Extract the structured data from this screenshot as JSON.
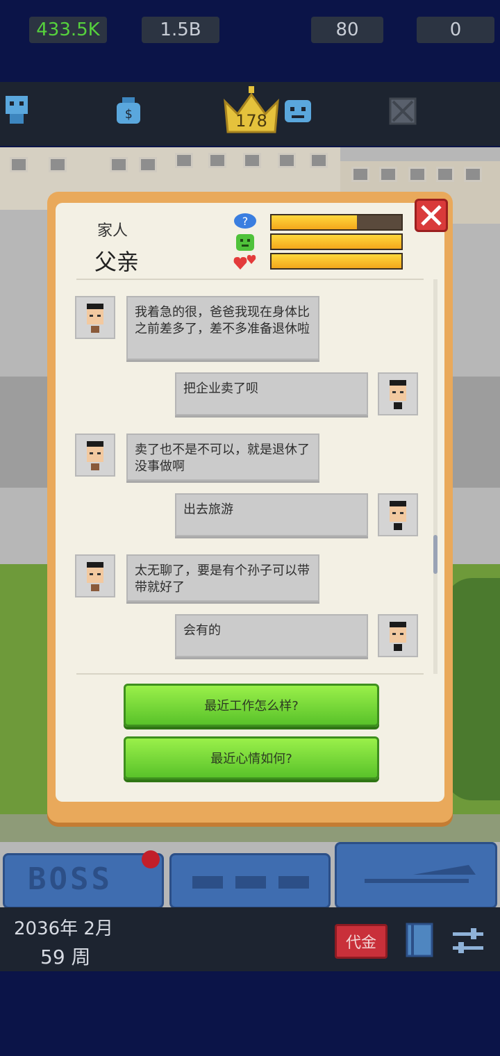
{
  "stats": {
    "employees": "433.5K",
    "money": "1.5B",
    "rank": "178",
    "happiness": "80",
    "blocked": "0"
  },
  "npc": {
    "category": "家人",
    "name": "父亲",
    "bars": {
      "mind": 0.66,
      "mood": 1.0,
      "affection": 1.0
    }
  },
  "messages": [
    {
      "from": "npc",
      "text": "我着急的很，爸爸我现在身体比之前差多了，差不多准备退休啦"
    },
    {
      "from": "player",
      "text": "把企业卖了呗"
    },
    {
      "from": "npc",
      "text": "卖了也不是不可以，就是退休了没事做啊"
    },
    {
      "from": "player",
      "text": "出去旅游"
    },
    {
      "from": "npc",
      "text": "太无聊了，要是有个孙子可以带带就好了"
    },
    {
      "from": "player",
      "text": "会有的"
    }
  ],
  "choices": [
    "最近工作怎么样?",
    "最近心情如何?"
  ],
  "bottom": {
    "boss_label": "BOSS",
    "date": "2036年 2月",
    "week": "59 周",
    "red_button_label": "代金"
  },
  "colors": {
    "green_stat": "#56d23d",
    "dialog_border": "#e9a95b",
    "choice_green": "#7ad93a"
  }
}
